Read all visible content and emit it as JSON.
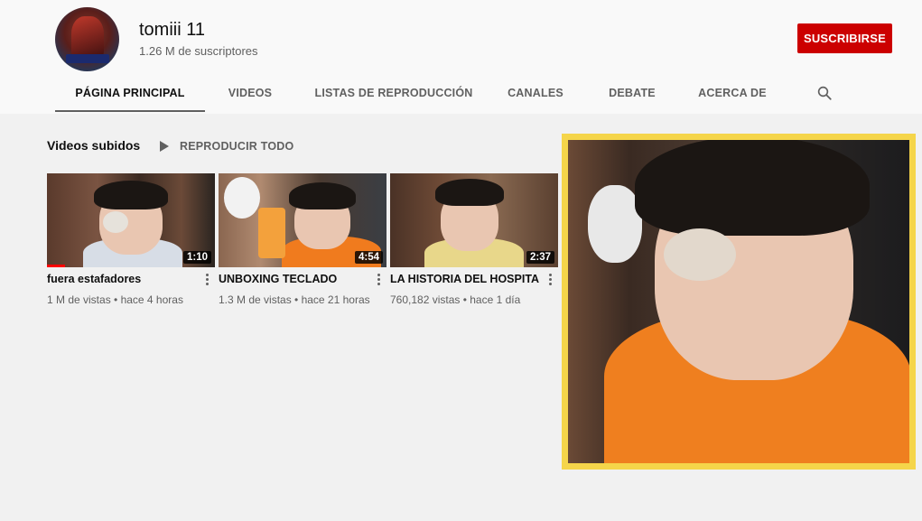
{
  "channel": {
    "name": "tomiii 11",
    "subscribers": "1.26 M de suscriptores",
    "subscribe_label": "SUSCRIBIRSE"
  },
  "tabs": [
    {
      "label": "PÁGINA PRINCIPAL",
      "active": true
    },
    {
      "label": "VIDEOS"
    },
    {
      "label": "LISTAS DE REPRODUCCIÓN"
    },
    {
      "label": "CANALES"
    },
    {
      "label": "DEBATE"
    },
    {
      "label": "ACERCA DE"
    }
  ],
  "section": {
    "title": "Videos subidos",
    "play_all": "REPRODUCIR TODO"
  },
  "videos": [
    {
      "title": "fuera estafadores",
      "duration": "1:10",
      "meta": "1 M de vistas • hace 4 horas",
      "watched_fraction": 0.11
    },
    {
      "title": "UNBOXING TECLADO",
      "duration": "4:54",
      "meta": "1.3 M de vistas • hace 21 horas"
    },
    {
      "title": "LA HISTORIA DEL HOSPITA",
      "duration": "2:37",
      "meta": "760,182 vistas • hace 1 día"
    }
  ],
  "colors": {
    "subscribe": "#cc0000",
    "overlay_border": "#f5d54a",
    "progress": "#ff0000"
  },
  "icons": [
    "search-icon",
    "play-icon",
    "more-vert-icon"
  ]
}
